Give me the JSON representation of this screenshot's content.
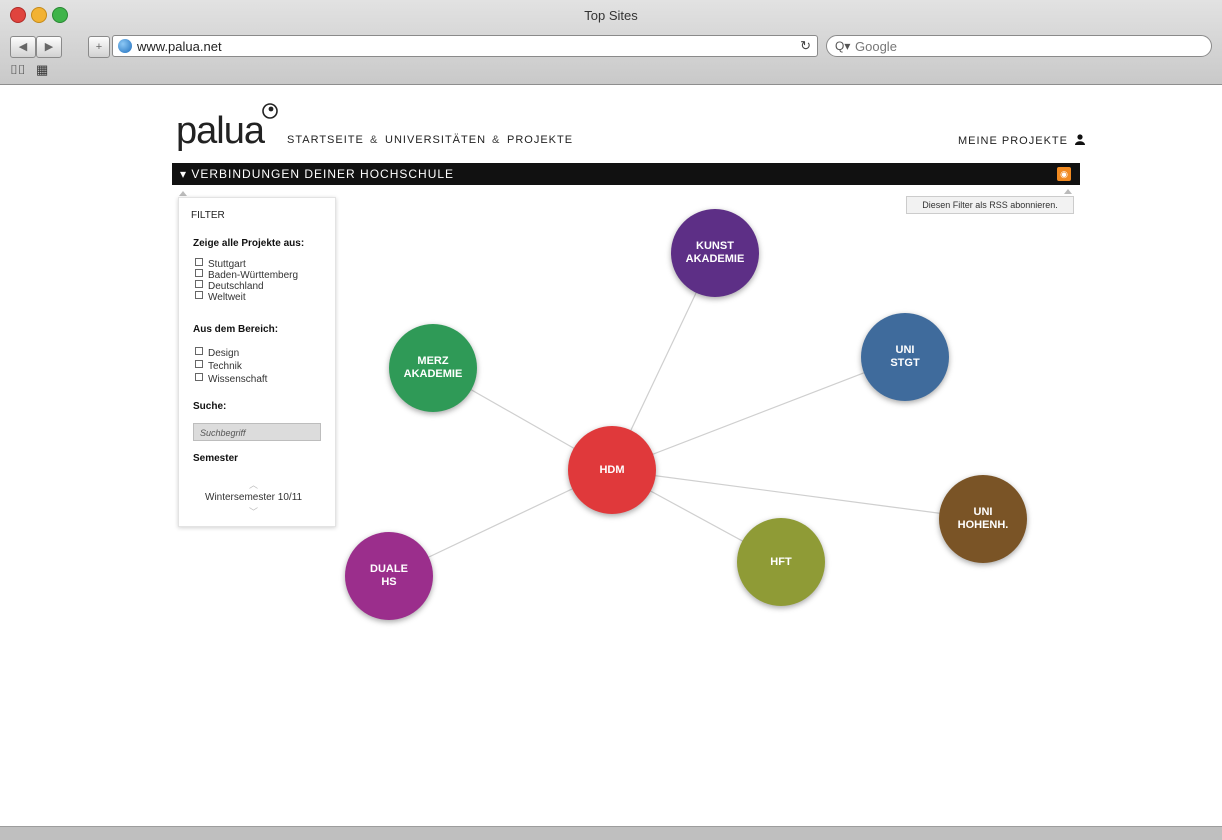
{
  "browser": {
    "window_title": "Top Sites",
    "url": "www.palua.net",
    "reload_glyph": "↻",
    "search_placeholder": "Google",
    "back_glyph": "◀",
    "forward_glyph": "▶",
    "add_glyph": "+",
    "bookmarks_glyph": "⌷⌷",
    "topsites_glyph": "▦"
  },
  "header": {
    "logo": "palua",
    "nav": [
      "STARTSEITE",
      "UNIVERSITÄTEN",
      "PROJEKTE"
    ],
    "nav_separator": "&",
    "my_projects": "MEINE PROJEKTE"
  },
  "bar": {
    "title": "▾ VERBINDUNGEN DEINER HOCHSCHULE",
    "rss_subscribe": "Diesen Filter als RSS abonnieren."
  },
  "filter": {
    "heading": "FILTER",
    "show_projects_label": "Zeige alle Projekte aus:",
    "locations": [
      "Stuttgart",
      "Baden-Württemberg",
      "Deutschland",
      "Weltweit"
    ],
    "area_label": "Aus dem Bereich:",
    "areas": [
      "Design",
      "Technik",
      "Wissenschaft"
    ],
    "search_label": "Suche:",
    "search_placeholder": "Suchbegriff",
    "semester_label": "Semester",
    "semester_value": "Wintersemester 10/11"
  },
  "graph": {
    "nodes": [
      {
        "id": "hdm",
        "label": "HDM",
        "color": "#e0393b"
      },
      {
        "id": "kunst",
        "label": "KUNST\nAKADEMIE",
        "color": "#5d2f86"
      },
      {
        "id": "merz",
        "label": "MERZ\nAKADEMIE",
        "color": "#2f9a57"
      },
      {
        "id": "unistgt",
        "label": "UNI\nSTGT",
        "color": "#3f6b9c"
      },
      {
        "id": "hohenh",
        "label": "UNI\nHOHENH.",
        "color": "#7a5426"
      },
      {
        "id": "hft",
        "label": "HFT",
        "color": "#8f9b36"
      },
      {
        "id": "duale",
        "label": "DUALE\nHS",
        "color": "#9b2e8c"
      }
    ]
  },
  "colors": {
    "black_bar": "#111111",
    "rss": "#f18a21"
  }
}
